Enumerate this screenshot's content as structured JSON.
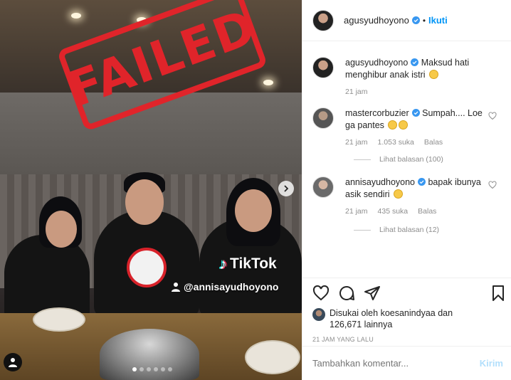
{
  "media": {
    "stamp_text": "FAILED",
    "tiktok_logo": "TikTok",
    "tiktok_username": "@annisayudhoyono",
    "carousel_dots": 6,
    "carousel_active_index": 0
  },
  "header": {
    "username": "agusyudhoyono",
    "separator": "•",
    "follow_label": "Ikuti"
  },
  "comments": [
    {
      "user": "agusyudhoyono",
      "text": "Maksud hati menghibur anak istri",
      "emojis": [
        "laughing-tears"
      ],
      "time": "21 jam",
      "likes": "",
      "reply_label": ""
    },
    {
      "user": "mastercorbuzier",
      "text": "Sumpah.... Loe ga pantes",
      "emojis": [
        "rolling-laughing",
        "rolling-laughing"
      ],
      "time": "21 jam",
      "likes": "1.053 suka",
      "reply_label": "Balas",
      "view_replies": "Lihat balasan (100)"
    },
    {
      "user": "annisayudhoyono",
      "text": "bapak ibunya asik sendiri",
      "emojis": [
        "grinning"
      ],
      "time": "21 jam",
      "likes": "435 suka",
      "reply_label": "Balas",
      "view_replies": "Lihat balasan (12)"
    }
  ],
  "likes": {
    "prefix": "Disukai oleh",
    "first_user": "koesanindyaa",
    "connector": "dan",
    "count": "126,671",
    "suffix": "lainnya"
  },
  "timestamp": "21 JAM YANG LALU",
  "add_comment": {
    "placeholder": "Tambahkan komentar...",
    "post_label": "Kirim"
  },
  "colors": {
    "accent": "#0095f6",
    "stamp_red": "#e0242a",
    "muted": "#8e8e8e"
  }
}
